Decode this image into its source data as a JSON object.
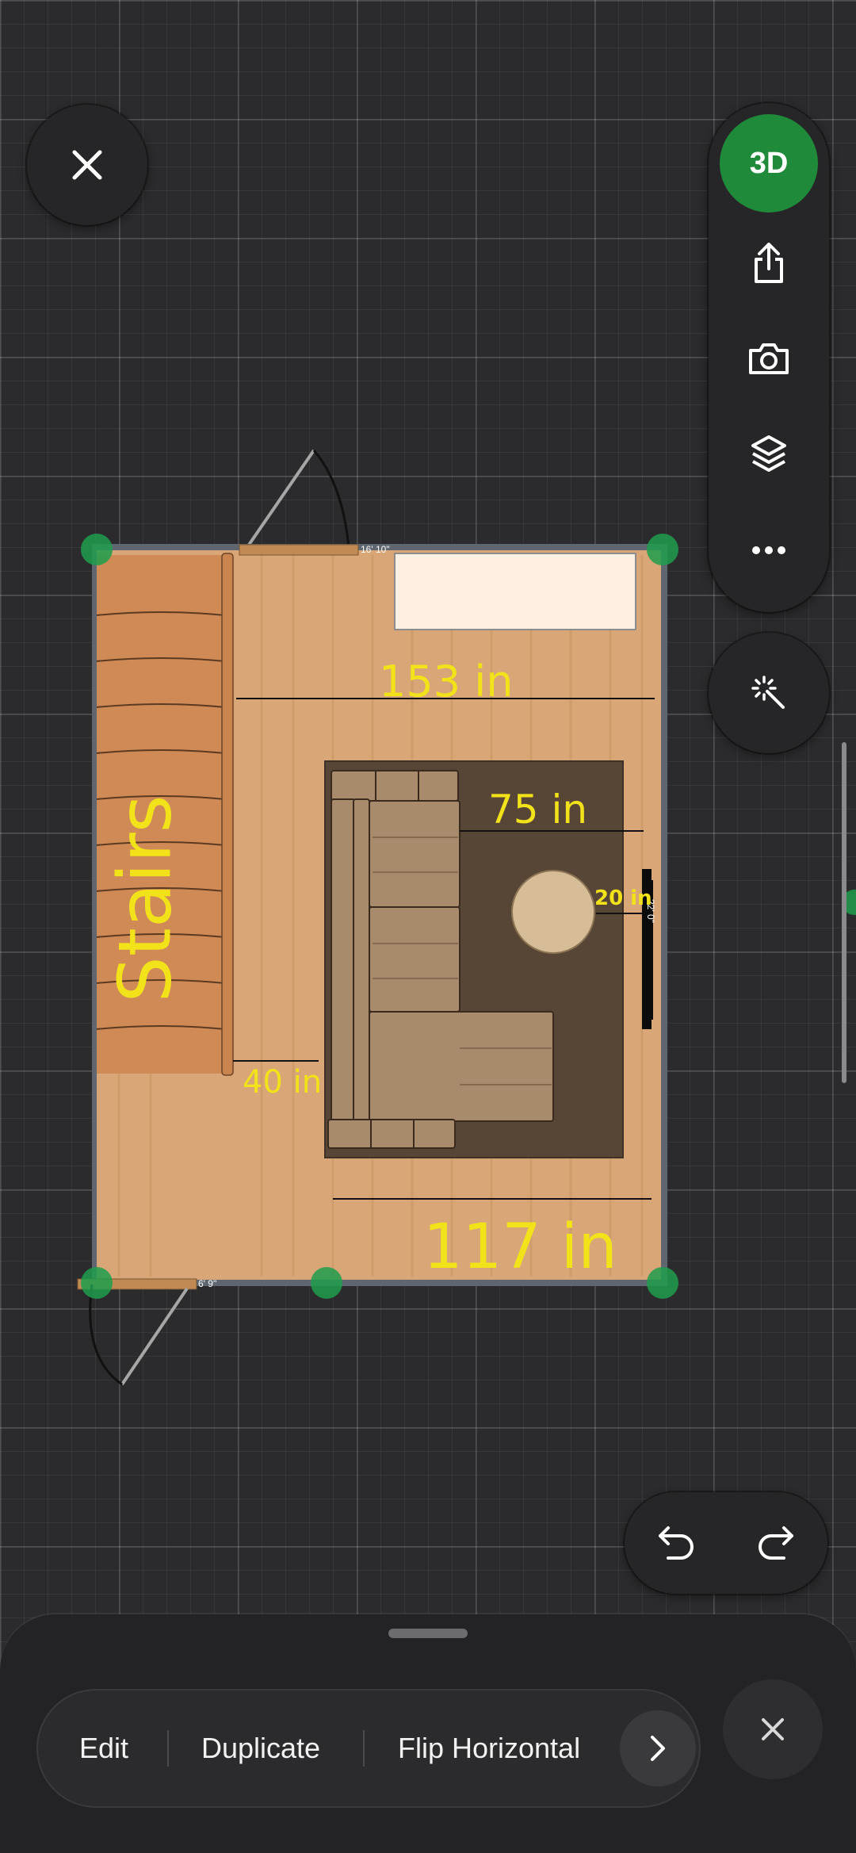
{
  "toolbar": {
    "view_3d_label": "3D",
    "icons": [
      "share-icon",
      "camera-icon",
      "layers-icon",
      "more-icon",
      "magic-wand-icon"
    ]
  },
  "plan": {
    "top_door_width": "16' 10\"",
    "bottom_door_width": "6' 9\"",
    "right_wall_length": "22' 0\"",
    "annotations": {
      "stairs": "Stairs",
      "d153": "153 in",
      "d75": "75 in",
      "d20": "20 in",
      "d40": "40 in",
      "d117": "117 in"
    },
    "colors": {
      "floor": "#d8a677",
      "stairs": "#d08a55",
      "rug": "#574536",
      "sofa": "#a88a6c",
      "table": "#d6bd97",
      "handle": "#1e9e4c",
      "annotation": "#f2e21a"
    }
  },
  "actions": {
    "edit": "Edit",
    "duplicate": "Duplicate",
    "flip": "Flip Horizontal"
  }
}
